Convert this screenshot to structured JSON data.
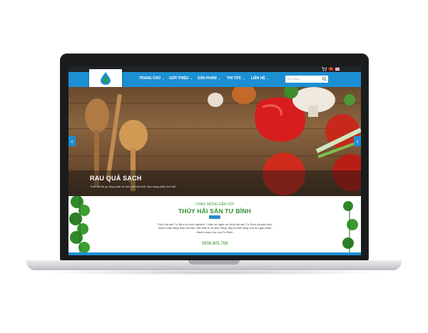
{
  "site": {
    "logo_text": "THỦY HẢI SẢN TƯ BÌNH",
    "nav": [
      "TRANG CHỦ",
      "GIỚI THIỆU",
      "SẢN PHẨM",
      "TIN TỨC",
      "LIÊN HỆ"
    ],
    "search_placeholder": "Tìm kiếm..."
  },
  "slider": {
    "title": "RAU QUẢ SẠCH",
    "subtitle": "Thời đại ăn gì cũng phải vệ sinh, tốt cho thể, bạn càng phải như thế",
    "prev_icon": "‹",
    "next_icon": "›"
  },
  "welcome": {
    "pre_title": "CHÀO MỪNG ĐẾN VỚI",
    "title": "THỦY HẢI SẢN TƯ BÌNH",
    "body": "Thủy hải sản Tư Bình có kinh nghiệm 7 năm về nghề cá, thủy hải sản Tư Bình chuyên kinh doanh mặt hàng thủy hải sản, đặc biệt là cá diêu hồng, đây là mặt hàng chủ lực góp phần thành công của vựa Tư Bình",
    "phone": "0938.805.768"
  },
  "colors": {
    "nav_blue": "#1c8fd3",
    "brand_green": "#2f8f2f",
    "laptop_body": "#1a1b1d"
  }
}
